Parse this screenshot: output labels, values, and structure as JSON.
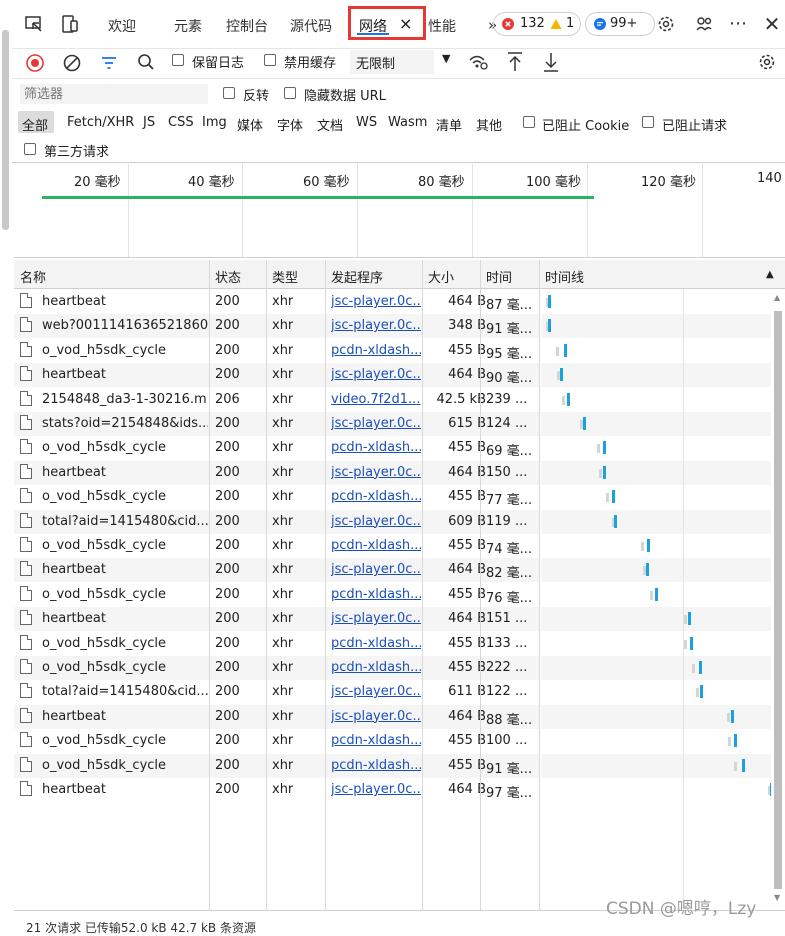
{
  "tabs": {
    "welcome": "欢迎",
    "elements": "元素",
    "console": "控制台",
    "sources": "源代码",
    "network": "网络",
    "performance_partial": "性能",
    "close": "×"
  },
  "badges": {
    "errors": "132",
    "warnings": "1",
    "issues": "99+"
  },
  "toolbar": {
    "preserve_log": "保留日志",
    "disable_cache": "禁用缓存",
    "throttling": "无限制"
  },
  "filter": {
    "placeholder": "筛选器",
    "invert": "反转",
    "hide_data_url": "隐藏数据 URL",
    "types": [
      "全部",
      "Fetch/XHR",
      "JS",
      "CSS",
      "Img",
      "媒体",
      "字体",
      "文档",
      "WS",
      "Wasm",
      "清单",
      "其他"
    ],
    "blocked_cookies": "已阻止 Cookie",
    "blocked_requests": "已阻止请求",
    "third_party": "第三方请求"
  },
  "overview": {
    "ticks": [
      "20 毫秒",
      "40 毫秒",
      "60 毫秒",
      "80 毫秒",
      "100 毫秒",
      "120 毫秒",
      "140"
    ]
  },
  "columns": {
    "name": "名称",
    "status": "状态",
    "type": "类型",
    "initiator": "发起程序",
    "size": "大小",
    "time": "时间",
    "waterfall": "时间线"
  },
  "requests": [
    {
      "name": "heartbeat",
      "status": "200",
      "type": "xhr",
      "initiator": "jsc-player.0c...",
      "size": "464 B",
      "time": "87 毫..."
    },
    {
      "name": "web?0011141636521860...",
      "status": "200",
      "type": "xhr",
      "initiator": "jsc-player.0c...",
      "size": "348 B",
      "time": "91 毫..."
    },
    {
      "name": "o_vod_h5sdk_cycle",
      "status": "200",
      "type": "xhr",
      "initiator": "pcdn-xldash...",
      "size": "455 B",
      "time": "95 毫..."
    },
    {
      "name": "heartbeat",
      "status": "200",
      "type": "xhr",
      "initiator": "jsc-player.0c...",
      "size": "464 B",
      "time": "90 毫..."
    },
    {
      "name": "2154848_da3-1-30216.m...",
      "status": "206",
      "type": "xhr",
      "initiator": "video.7f2d1...",
      "size": "42.5 kB",
      "time": "239 ..."
    },
    {
      "name": "stats?oid=2154848&ids...",
      "status": "200",
      "type": "xhr",
      "initiator": "jsc-player.0c...",
      "size": "615 B",
      "time": "124 ..."
    },
    {
      "name": "o_vod_h5sdk_cycle",
      "status": "200",
      "type": "xhr",
      "initiator": "pcdn-xldash...",
      "size": "455 B",
      "time": "69 毫..."
    },
    {
      "name": "heartbeat",
      "status": "200",
      "type": "xhr",
      "initiator": "jsc-player.0c...",
      "size": "464 B",
      "time": "150 ..."
    },
    {
      "name": "o_vod_h5sdk_cycle",
      "status": "200",
      "type": "xhr",
      "initiator": "pcdn-xldash...",
      "size": "455 B",
      "time": "77 毫..."
    },
    {
      "name": "total?aid=1415480&cid...",
      "status": "200",
      "type": "xhr",
      "initiator": "jsc-player.0c...",
      "size": "609 B",
      "time": "119 ..."
    },
    {
      "name": "o_vod_h5sdk_cycle",
      "status": "200",
      "type": "xhr",
      "initiator": "pcdn-xldash...",
      "size": "455 B",
      "time": "74 毫..."
    },
    {
      "name": "heartbeat",
      "status": "200",
      "type": "xhr",
      "initiator": "jsc-player.0c...",
      "size": "464 B",
      "time": "82 毫..."
    },
    {
      "name": "o_vod_h5sdk_cycle",
      "status": "200",
      "type": "xhr",
      "initiator": "pcdn-xldash...",
      "size": "455 B",
      "time": "76 毫..."
    },
    {
      "name": "heartbeat",
      "status": "200",
      "type": "xhr",
      "initiator": "jsc-player.0c...",
      "size": "464 B",
      "time": "151 ..."
    },
    {
      "name": "o_vod_h5sdk_cycle",
      "status": "200",
      "type": "xhr",
      "initiator": "pcdn-xldash...",
      "size": "455 B",
      "time": "133 ..."
    },
    {
      "name": "o_vod_h5sdk_cycle",
      "status": "200",
      "type": "xhr",
      "initiator": "pcdn-xldash...",
      "size": "455 B",
      "time": "222 ..."
    },
    {
      "name": "total?aid=1415480&cid...",
      "status": "200",
      "type": "xhr",
      "initiator": "jsc-player.0c...",
      "size": "611 B",
      "time": "122 ..."
    },
    {
      "name": "heartbeat",
      "status": "200",
      "type": "xhr",
      "initiator": "jsc-player.0c...",
      "size": "464 B",
      "time": "88 毫..."
    },
    {
      "name": "o_vod_h5sdk_cycle",
      "status": "200",
      "type": "xhr",
      "initiator": "pcdn-xldash...",
      "size": "455 B",
      "time": "100 ..."
    },
    {
      "name": "o_vod_h5sdk_cycle",
      "status": "200",
      "type": "xhr",
      "initiator": "pcdn-xldash...",
      "size": "455 B",
      "time": "91 毫..."
    },
    {
      "name": "heartbeat",
      "status": "200",
      "type": "xhr",
      "initiator": "jsc-player.0c...",
      "size": "464 B",
      "time": "97 毫..."
    }
  ],
  "status_bar": "21 次请求  已传输52.0 kB  42.7 kB 条资源",
  "watermark": "CSDN @嗯哼，Lzy",
  "colors": {
    "accent": "#1a73e8",
    "highlight_box": "#e53935",
    "error": "#e53935",
    "warning": "#f4b400",
    "link": "#1a4fb8",
    "overview_bar": "#28b463",
    "waterfall": "#1ba1e2"
  }
}
